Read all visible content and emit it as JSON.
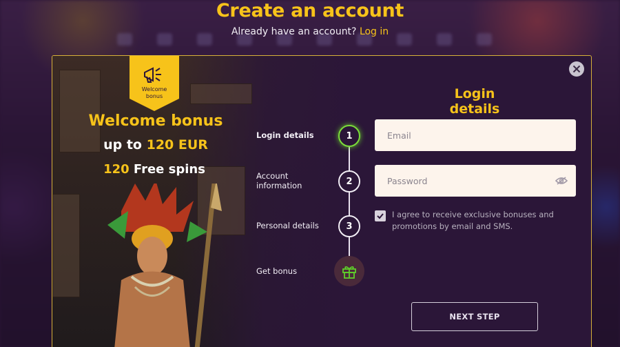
{
  "header": {
    "title": "Create an account",
    "subtitle_prefix": "Already have an account?",
    "login_link": "Log in"
  },
  "promo": {
    "flag_line1": "Welcome",
    "flag_line2": "bonus",
    "heading": "Welcome bonus",
    "amount_prefix": "up to",
    "amount_value": "120 EUR",
    "spins_count": "120",
    "spins_label": "Free spins"
  },
  "steps": [
    {
      "label": "Login details",
      "number": "1"
    },
    {
      "label_line1": "Account",
      "label_line2": "information",
      "number": "2"
    },
    {
      "label": "Personal details",
      "number": "3"
    },
    {
      "label": "Get bonus",
      "icon": "gift-icon"
    }
  ],
  "form": {
    "title": "Login details",
    "email_placeholder": "Email",
    "email_value": "",
    "password_placeholder": "Password",
    "password_value": "",
    "consent_checked": true,
    "consent_text": "I agree to receive exclusive bonuses and promotions by email and SMS.",
    "next_label": "NEXT STEP"
  },
  "colors": {
    "accent": "#f7c31a",
    "active_step": "#7bdc3a",
    "background": "#2b1638",
    "input_bg": "#fdf4ec"
  },
  "icons": {
    "close": "close-icon",
    "megaphone": "megaphone-icon",
    "eye": "eye-off-icon",
    "checkbox": "checkmark-icon",
    "gift": "gift-icon"
  }
}
